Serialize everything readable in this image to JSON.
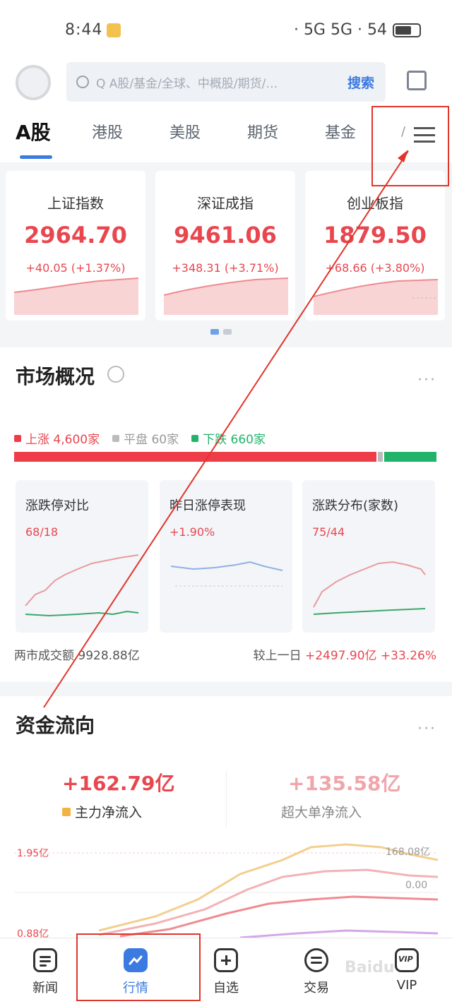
{
  "status_bar": {
    "time": "8:44",
    "signal": "· 5G 5G · 54",
    "battery_icon": "battery-icon"
  },
  "search": {
    "placeholder": "Q A股/基金/全球、中概股/期货/…",
    "button_label": "搜索"
  },
  "tabs": {
    "items": [
      "A股",
      "港股",
      "美股",
      "期货",
      "基金"
    ],
    "active": "A股",
    "menu_prefix": "/"
  },
  "indices": [
    {
      "name": "上证指数",
      "value": "2964.70",
      "change": "+40.05 (+1.37%)"
    },
    {
      "name": "深证成指",
      "value": "9461.06",
      "change": "+348.31 (+3.71%)"
    },
    {
      "name": "创业板指",
      "value": "1879.50",
      "change": "+68.66 (+3.80%)"
    }
  ],
  "market_overview": {
    "title": "市场概况",
    "more": "···",
    "legend": {
      "up": "上涨 4,600家",
      "flat": "平盘 60家",
      "down": "下跌 660家"
    },
    "breadth": {
      "up": 4600,
      "flat": 60,
      "down": 660
    },
    "cards": [
      {
        "title": "涨跌停对比",
        "value": "68/18",
        "value_color": "#e8474f"
      },
      {
        "title": "昨日涨停表现",
        "value": "+1.90%",
        "value_color": "#e8474f"
      },
      {
        "title": "涨跌分布(家数)",
        "value": "75/44",
        "value_color": "#e8474f"
      }
    ],
    "turnover": "两市成交额 9928.88亿",
    "compare_label": "较上一日",
    "compare_value": "+2497.90亿 +33.26%"
  },
  "fund_flow": {
    "title": "资金流向",
    "more": "···",
    "left_value": "+162.79亿",
    "left_label": "主力净流入",
    "right_value": "+135.58亿",
    "right_label": "超大单净流入",
    "axis_top": "1.95亿",
    "axis_bottom": "0.88亿",
    "right_axis_top": "168.08亿",
    "right_axis_mid": "0.00"
  },
  "tabbar": [
    {
      "label": "新闻",
      "icon": "news-icon"
    },
    {
      "label": "行情",
      "icon": "market-chart-icon"
    },
    {
      "label": "自选",
      "icon": "add-watchlist-icon"
    },
    {
      "label": "交易",
      "icon": "trade-exchange-icon"
    },
    {
      "label": "VIP",
      "icon": "vip-icon"
    }
  ],
  "colors": {
    "accent": "#3b7ae0",
    "up": "#e8474f",
    "down": "#22b36b",
    "flat": "#bcbcbc",
    "annotation": "#e0352b"
  },
  "watermark": "Baidu"
}
